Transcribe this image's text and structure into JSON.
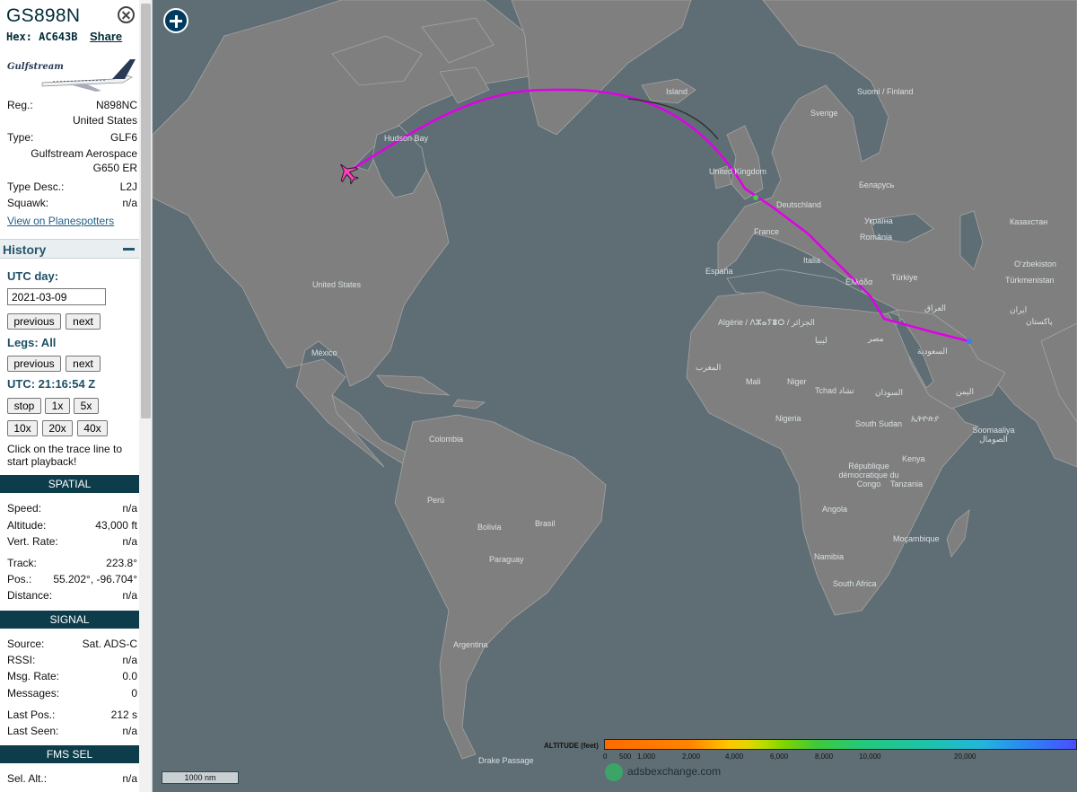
{
  "aircraft": {
    "callsign": "GS898N",
    "hex_label": "Hex:",
    "hex": "AC643B",
    "share": "Share",
    "photo_caption": "Gulfstream"
  },
  "details": [
    {
      "key": "Reg.:",
      "value": "N898NC"
    },
    {
      "key": "",
      "value": "United States"
    },
    {
      "key": "Type:",
      "value": "GLF6"
    },
    {
      "key": "",
      "value": "Gulfstream Aerospace"
    },
    {
      "key": "",
      "value": "G650 ER"
    },
    {
      "key": "Type Desc.:",
      "value": "L2J"
    },
    {
      "key": "Squawk:",
      "value": "n/a"
    }
  ],
  "spotters_link": "View on Planespotters",
  "history": {
    "title": "History",
    "utc_day_label": "UTC day:",
    "date": "2021-03-09",
    "previous": "previous",
    "next": "next",
    "legs_label": "Legs: All",
    "utc_time": "UTC: 21:16:54 Z",
    "speeds": [
      "stop",
      "1x",
      "5x",
      "10x",
      "20x",
      "40x"
    ],
    "hint": "Click on the trace line to start playback!"
  },
  "spatial": {
    "title": "SPATIAL",
    "rows": [
      {
        "key": "Speed:",
        "value": "n/a"
      },
      {
        "key": "Altitude:",
        "value": "43,000 ft"
      },
      {
        "key": "Vert. Rate:",
        "value": "n/a"
      },
      {
        "key": "Track:",
        "value": "223.8°"
      },
      {
        "key": "Pos.:",
        "value": "55.202°, -96.704°"
      },
      {
        "key": "Distance:",
        "value": "n/a"
      }
    ]
  },
  "signal": {
    "title": "SIGNAL",
    "rows": [
      {
        "key": "Source:",
        "value": "Sat. ADS-C"
      },
      {
        "key": "RSSI:",
        "value": "n/a"
      },
      {
        "key": "Msg. Rate:",
        "value": "0.0"
      },
      {
        "key": "Messages:",
        "value": "0"
      },
      {
        "key": "Last Pos.:",
        "value": "212 s"
      },
      {
        "key": "Last Seen:",
        "value": "n/a"
      }
    ]
  },
  "fms": {
    "title": "FMS SEL",
    "rows": [
      {
        "key": "Sel. Alt.:",
        "value": "n/a"
      }
    ]
  },
  "map": {
    "scale": "1000 nm",
    "altitude_title": "ALTITUDE (feet)",
    "altitude_ticks": [
      "0",
      "500",
      "1,000",
      "2,000",
      "4,000",
      "6,000",
      "8,000",
      "10,000",
      "20,000"
    ],
    "brand": "adsbexchange.com",
    "labels": [
      "Island",
      "Suomi / Finland",
      "Sverige",
      "United Kingdom",
      "Deutschland",
      "Беларусь",
      "Україна",
      "France",
      "România",
      "Казахстан",
      "España",
      "Italia",
      "Türkiye",
      "Oʻzbekiston",
      "Türkmenistan",
      "Ελλάδα",
      "Algérie / ⴷⵣⴰⵢⴻⵔ / الجزائر",
      "ليبيا",
      "مصر",
      "العراق",
      "ایران",
      "السعودية",
      "پاکستان",
      "المغرب",
      "Mali",
      "Niger",
      "Tchad تشاد",
      "السودان",
      "اليمن",
      "Nigeria",
      "South Sudan",
      "ኢትዮጵያ",
      "Soomaaliya الصومال",
      "République démocratique du Congo",
      "Kenya",
      "Tanzania",
      "Angola",
      "Moçambique",
      "Namibia",
      "South Africa",
      "Hudson Bay",
      "United States",
      "México",
      "Colombia",
      "Perú",
      "Brasil",
      "Bolivia",
      "Paraguay",
      "Argentina",
      "Drake Passage"
    ],
    "colors": {
      "ocean": "#5f6e74",
      "land": "#7f7f7f",
      "trace": "#e000e8",
      "header": "#0d3d4a"
    }
  }
}
